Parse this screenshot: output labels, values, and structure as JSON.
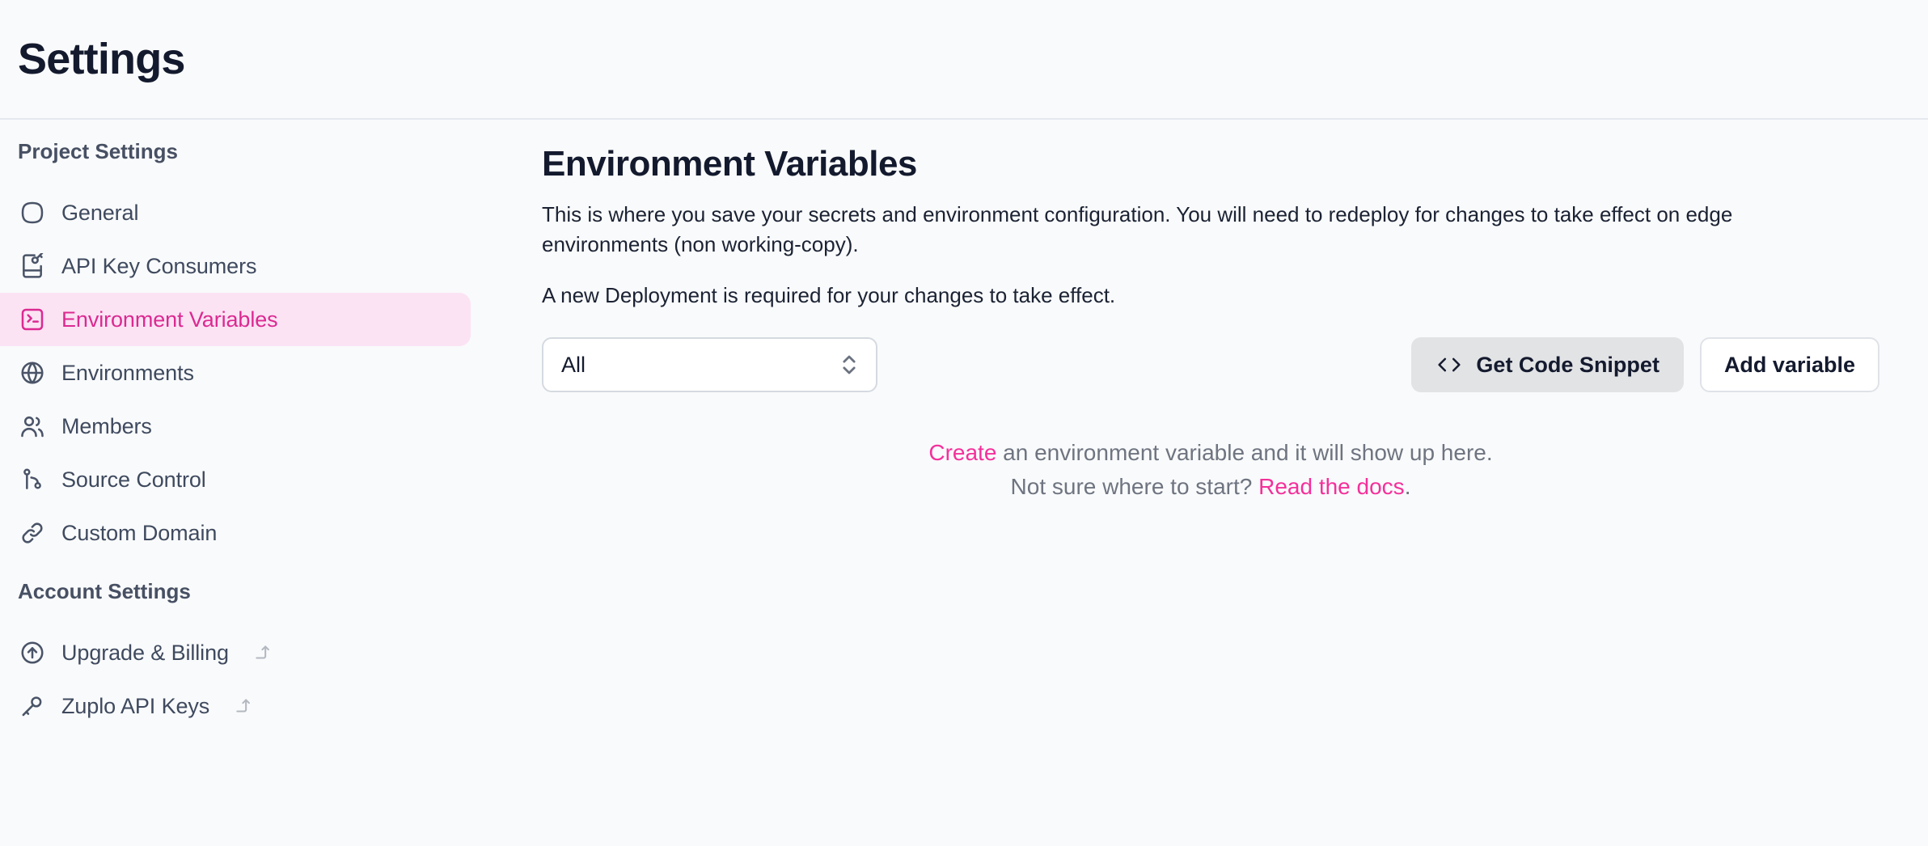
{
  "header": {
    "title": "Settings"
  },
  "sidebar": {
    "groups": [
      {
        "label": "Project Settings",
        "items": [
          {
            "label": "General",
            "icon": "squircle-icon",
            "external": false
          },
          {
            "label": "API Key Consumers",
            "icon": "file-key-icon",
            "external": false
          },
          {
            "label": "Environment Variables",
            "icon": "square-terminal-icon",
            "external": false,
            "active": true
          },
          {
            "label": "Environments",
            "icon": "globe-icon",
            "external": false
          },
          {
            "label": "Members",
            "icon": "users-icon",
            "external": false
          },
          {
            "label": "Source Control",
            "icon": "git-branch-icon",
            "external": false
          },
          {
            "label": "Custom Domain",
            "icon": "link-icon",
            "external": false
          }
        ]
      },
      {
        "label": "Account Settings",
        "items": [
          {
            "label": "Upgrade & Billing",
            "icon": "circle-arrow-up-icon",
            "external": true
          },
          {
            "label": "Zuplo API Keys",
            "icon": "key-icon",
            "external": true
          }
        ]
      }
    ]
  },
  "main": {
    "title": "Environment Variables",
    "description": "This is where you save your secrets and environment configuration. You will need to redeploy for changes to take effect on edge environments (non working-copy).",
    "note": "A new Deployment is required for your changes to take effect.",
    "filter": {
      "value": "All",
      "options": [
        "All"
      ]
    },
    "actions": {
      "get_code_snippet": "Get Code Snippet",
      "add_variable": "Add variable"
    },
    "empty_state": {
      "line1_link": "Create",
      "line1_rest": " an environment variable and it will show up here.",
      "line2_prefix": "Not sure where to start? ",
      "line2_link": "Read the docs",
      "line2_suffix": "."
    }
  },
  "colors": {
    "accent_pink": "#f4309b",
    "active_pink_text": "#db2a91",
    "active_pink_bg": "#fbe3f4",
    "page_bg": "#f9fafb",
    "text_dark": "#141a2e",
    "text_muted": "#6e7480"
  }
}
